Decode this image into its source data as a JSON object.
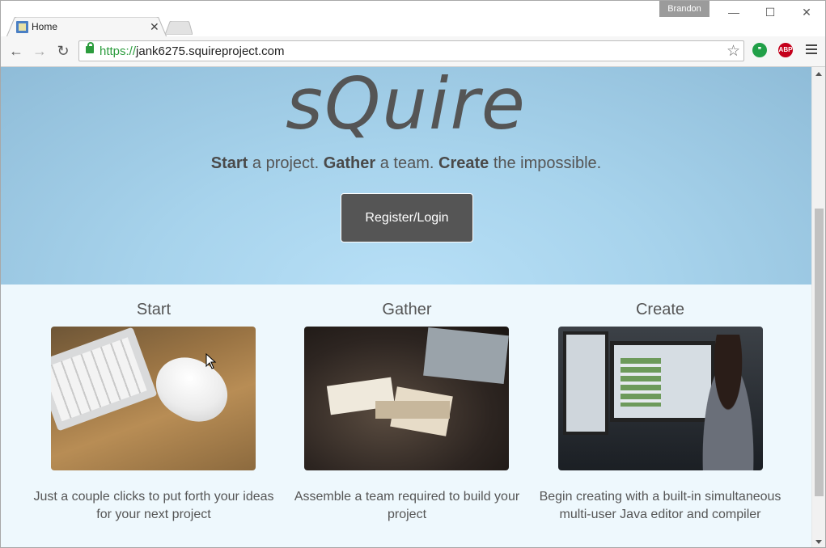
{
  "browser": {
    "tab_title": "Home",
    "profile_name": "Brandon",
    "url_scheme": "https://",
    "url_host": "jank6275.squireproject.com",
    "extension_abp_label": "ABP"
  },
  "hero": {
    "logo": "sQuire",
    "tagline": [
      {
        "bold": "Start",
        "rest": " a project. "
      },
      {
        "bold": "Gather",
        "rest": " a team. "
      },
      {
        "bold": "Create",
        "rest": " the impossible."
      }
    ],
    "cta_label": "Register/Login"
  },
  "features": [
    {
      "title": "Start",
      "description": "Just a couple clicks to put forth your ideas for your next project"
    },
    {
      "title": "Gather",
      "description": "Assemble a team required to build your project"
    },
    {
      "title": "Create",
      "description": "Begin creating with a built-in simultaneous multi-user Java editor and compiler"
    }
  ],
  "icons": {
    "back": "back-arrow-icon",
    "forward": "forward-arrow-icon",
    "reload": "reload-icon",
    "lock": "lock-icon",
    "star": "star-icon",
    "hangouts": "hangouts-icon",
    "adblock": "adblock-plus-icon",
    "menu": "hamburger-menu-icon"
  },
  "colors": {
    "hero_bg": "#a7d3ec",
    "page_bg": "#eef8fd",
    "button_bg": "#555555",
    "secure_green": "#2c9c3d",
    "abp_red": "#c4001b",
    "hangouts_green": "#21a048"
  }
}
